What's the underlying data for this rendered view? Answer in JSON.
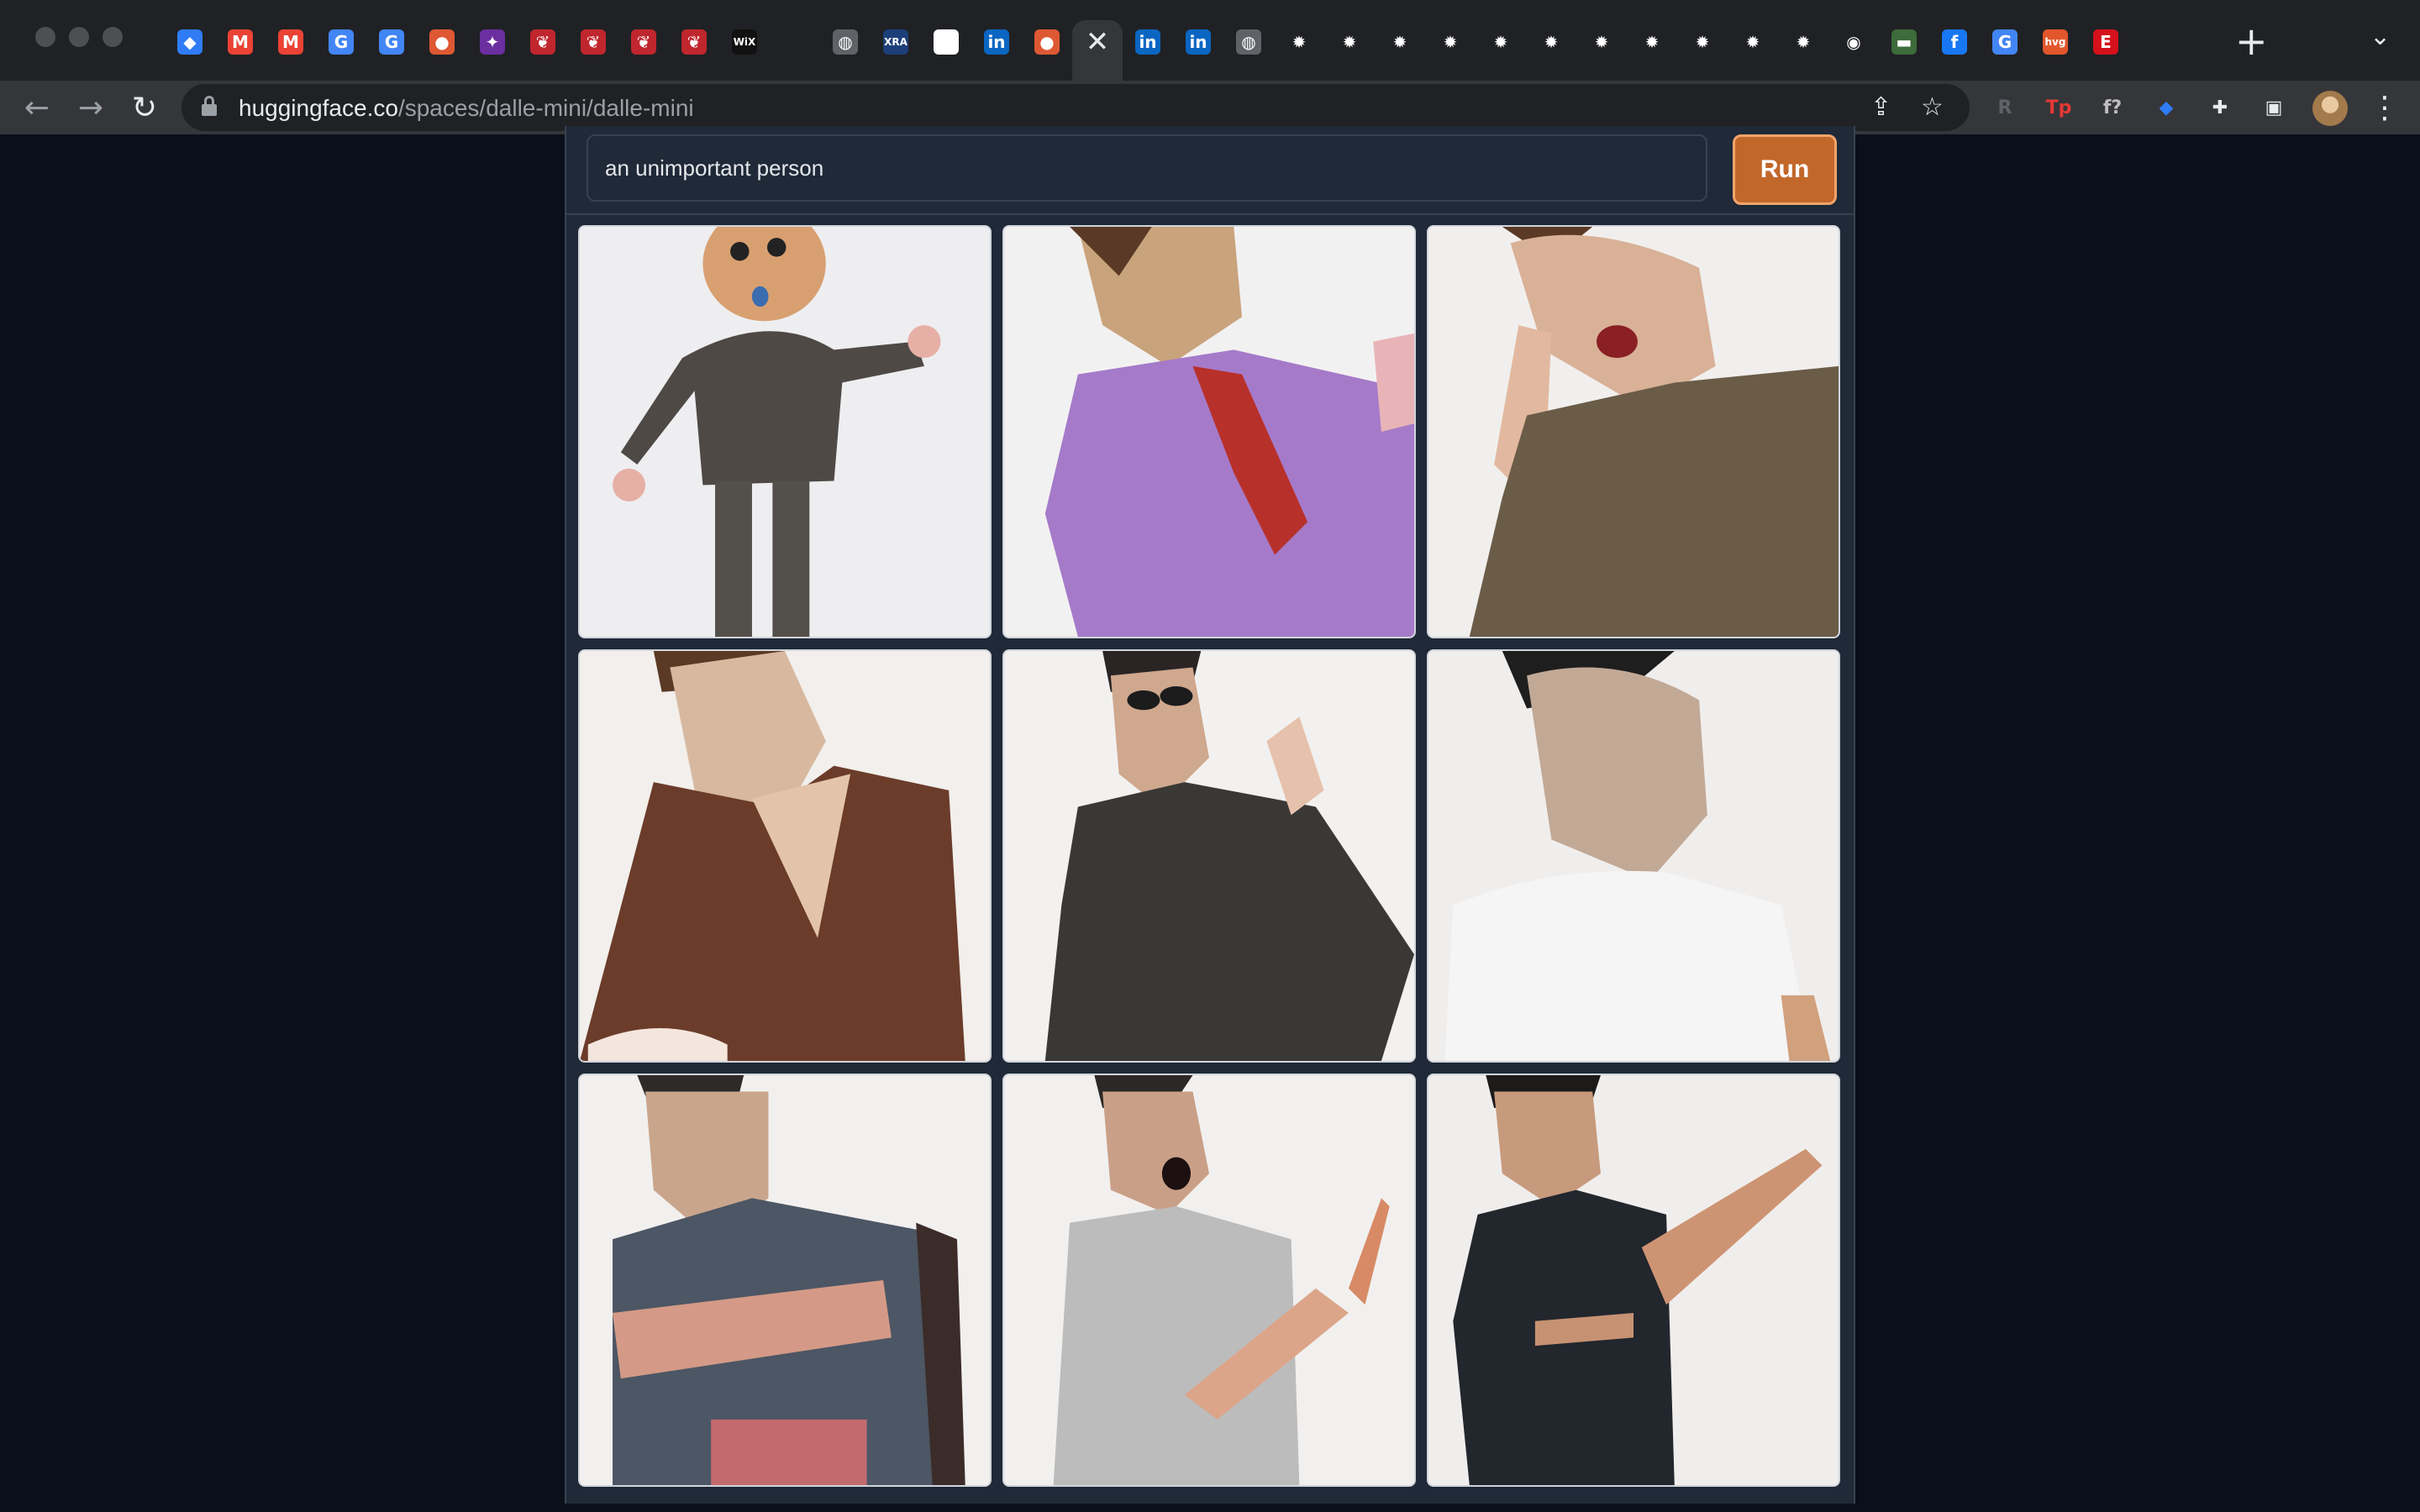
{
  "browser": {
    "url_host": "huggingface.co",
    "url_path": "/spaces/dalle-mini/dalle-mini",
    "tabs": [
      {
        "icon": "sapphire-icon",
        "glyph": "◆",
        "color": "#2f7cf6"
      },
      {
        "icon": "gmail-icon",
        "glyph": "M",
        "color": "#ea4335"
      },
      {
        "icon": "gmail-icon",
        "glyph": "M",
        "color": "#ea4335"
      },
      {
        "icon": "google-icon",
        "glyph": "G",
        "color": "#4285f4"
      },
      {
        "icon": "google-icon",
        "glyph": "G",
        "color": "#4285f4"
      },
      {
        "icon": "duckduckgo-icon",
        "glyph": "●",
        "color": "#de5833"
      },
      {
        "icon": "purple-app-icon",
        "glyph": "✦",
        "color": "#6b2fa0"
      },
      {
        "icon": "red-bird-icon",
        "glyph": "❦",
        "color": "#c0262d"
      },
      {
        "icon": "red-bird-icon",
        "glyph": "❦",
        "color": "#c0262d"
      },
      {
        "icon": "red-bird-icon",
        "glyph": "❦",
        "color": "#c0262d"
      },
      {
        "icon": "red-bird-icon",
        "glyph": "❦",
        "color": "#c0262d"
      },
      {
        "icon": "wix-icon",
        "glyph": "WiX",
        "color": "#111111"
      },
      {
        "icon": "blank-icon",
        "glyph": "",
        "color": "#202124"
      },
      {
        "icon": "globe-icon",
        "glyph": "◍",
        "color": "#5f6368"
      },
      {
        "icon": "xra-icon",
        "glyph": "XRA",
        "color": "#1c3f7a"
      },
      {
        "icon": "white-square-icon",
        "glyph": "",
        "color": "#ffffff"
      },
      {
        "icon": "linkedin-icon",
        "glyph": "in",
        "color": "#0a66c2"
      },
      {
        "icon": "huggingface-icon",
        "glyph": "●",
        "color": "#de5833"
      },
      {
        "icon": "close-tab-icon",
        "glyph": "✕",
        "color": "#35363a",
        "active": true
      },
      {
        "icon": "linkedin-icon",
        "glyph": "in",
        "color": "#0a66c2"
      },
      {
        "icon": "linkedin-icon",
        "glyph": "in",
        "color": "#0a66c2"
      },
      {
        "icon": "globe-icon",
        "glyph": "◍",
        "color": "#5f6368"
      },
      {
        "icon": "gear-icon",
        "glyph": "✹",
        "color": "#202124"
      },
      {
        "icon": "gear-icon",
        "glyph": "✹",
        "color": "#202124"
      },
      {
        "icon": "gear-icon",
        "glyph": "✹",
        "color": "#202124"
      },
      {
        "icon": "gear-icon",
        "glyph": "✹",
        "color": "#202124"
      },
      {
        "icon": "gear-icon",
        "glyph": "✹",
        "color": "#202124"
      },
      {
        "icon": "gear-icon",
        "glyph": "✹",
        "color": "#202124"
      },
      {
        "icon": "gear-icon",
        "glyph": "✹",
        "color": "#202124"
      },
      {
        "icon": "gear-icon",
        "glyph": "✹",
        "color": "#202124"
      },
      {
        "icon": "gear-icon",
        "glyph": "✹",
        "color": "#202124"
      },
      {
        "icon": "gear-icon",
        "glyph": "✹",
        "color": "#202124"
      },
      {
        "icon": "gear-icon",
        "glyph": "✹",
        "color": "#202124"
      },
      {
        "icon": "github-icon",
        "glyph": "◉",
        "color": "#202124"
      },
      {
        "icon": "green-app-icon",
        "glyph": "▬",
        "color": "#3d6b3a"
      },
      {
        "icon": "facebook-icon",
        "glyph": "f",
        "color": "#1877f2"
      },
      {
        "icon": "google-icon",
        "glyph": "G",
        "color": "#4285f4"
      },
      {
        "icon": "hvg-icon",
        "glyph": "hvg",
        "color": "#e2562c"
      },
      {
        "icon": "etsy-icon",
        "glyph": "E",
        "color": "#d5111b"
      }
    ],
    "extensions": [
      {
        "icon": "bookmark-r-icon",
        "glyph": "R",
        "color": "#5f6368"
      },
      {
        "icon": "tp-icon",
        "glyph": "Tp",
        "color": "#e53935"
      },
      {
        "icon": "function-icon",
        "glyph": "f?",
        "color": "#bdbdbd"
      },
      {
        "icon": "sapphire-icon",
        "glyph": "◆",
        "color": "#2f7cf6"
      },
      {
        "icon": "puzzle-icon",
        "glyph": "✚",
        "color": "#e8eaed"
      },
      {
        "icon": "sidebar-icon",
        "glyph": "▣",
        "color": "#e8eaed"
      }
    ]
  },
  "app": {
    "prompt_value": "an unimportant person",
    "run_label": "Run",
    "accent": "#c2672a",
    "images": [
      {
        "alt": "cartoon bald figure in grey outfit"
      },
      {
        "alt": "man in purple shirt with red tie"
      },
      {
        "alt": "man in brown t-shirt hand to head"
      },
      {
        "alt": "man in brown v-neck shirt"
      },
      {
        "alt": "man with glasses in dark shirt"
      },
      {
        "alt": "man in white t-shirt"
      },
      {
        "alt": "man in denim shirt arms crossed"
      },
      {
        "alt": "man in grey t-shirt pointing"
      },
      {
        "alt": "man in navy t-shirt gesturing"
      }
    ]
  }
}
